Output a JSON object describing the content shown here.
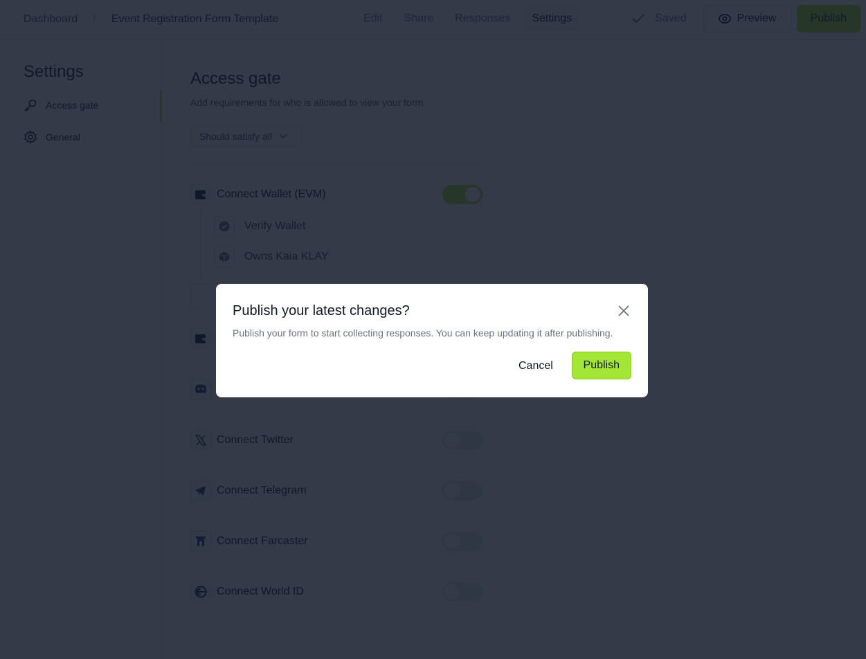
{
  "header": {
    "breadcrumb_home": "Dashboard",
    "breadcrumb_separator": "/",
    "breadcrumb_current": "Event Registration Form Template",
    "tabs": [
      {
        "label": "Edit",
        "active": false
      },
      {
        "label": "Share",
        "active": false
      },
      {
        "label": "Responses",
        "active": false
      },
      {
        "label": "Settings",
        "active": true
      }
    ],
    "saved_label": "Saved",
    "preview_label": "Preview",
    "publish_label": "Publish"
  },
  "sidebar": {
    "title": "Settings",
    "items": [
      {
        "label": "Access gate",
        "icon": "key-icon",
        "active": true
      },
      {
        "label": "General",
        "icon": "gear-icon",
        "active": false
      }
    ]
  },
  "main": {
    "title": "Access gate",
    "subtitle": "Add requirements for who is allowed to view your form",
    "condition_select": "Should satisfy all",
    "gates": [
      {
        "label": "Connect Wallet (EVM)",
        "icon": "wallet-icon",
        "enabled": true,
        "sub_items": [
          {
            "label": "Verify Wallet",
            "icon": "verified-badge-icon"
          },
          {
            "label": "Owns Kaia KLAY",
            "icon": "cube-icon"
          }
        ]
      },
      {
        "label": "",
        "icon": "wallet-icon",
        "enabled": false
      },
      {
        "label": "",
        "icon": "discord-icon",
        "enabled": false
      },
      {
        "label": "Connect Twitter",
        "icon": "x-twitter-icon",
        "enabled": false
      },
      {
        "label": "Connect Telegram",
        "icon": "telegram-icon",
        "enabled": false
      },
      {
        "label": "Connect Farcaster",
        "icon": "farcaster-icon",
        "enabled": false
      },
      {
        "label": "Connect World ID",
        "icon": "worldcoin-icon",
        "enabled": false
      }
    ]
  },
  "modal": {
    "title": "Publish your latest changes?",
    "description": "Publish your form to start collecting responses. You can keep updating it after publishing.",
    "cancel_label": "Cancel",
    "publish_label": "Publish"
  },
  "colors": {
    "accent": "#a3e635",
    "overlay": "#111827"
  }
}
